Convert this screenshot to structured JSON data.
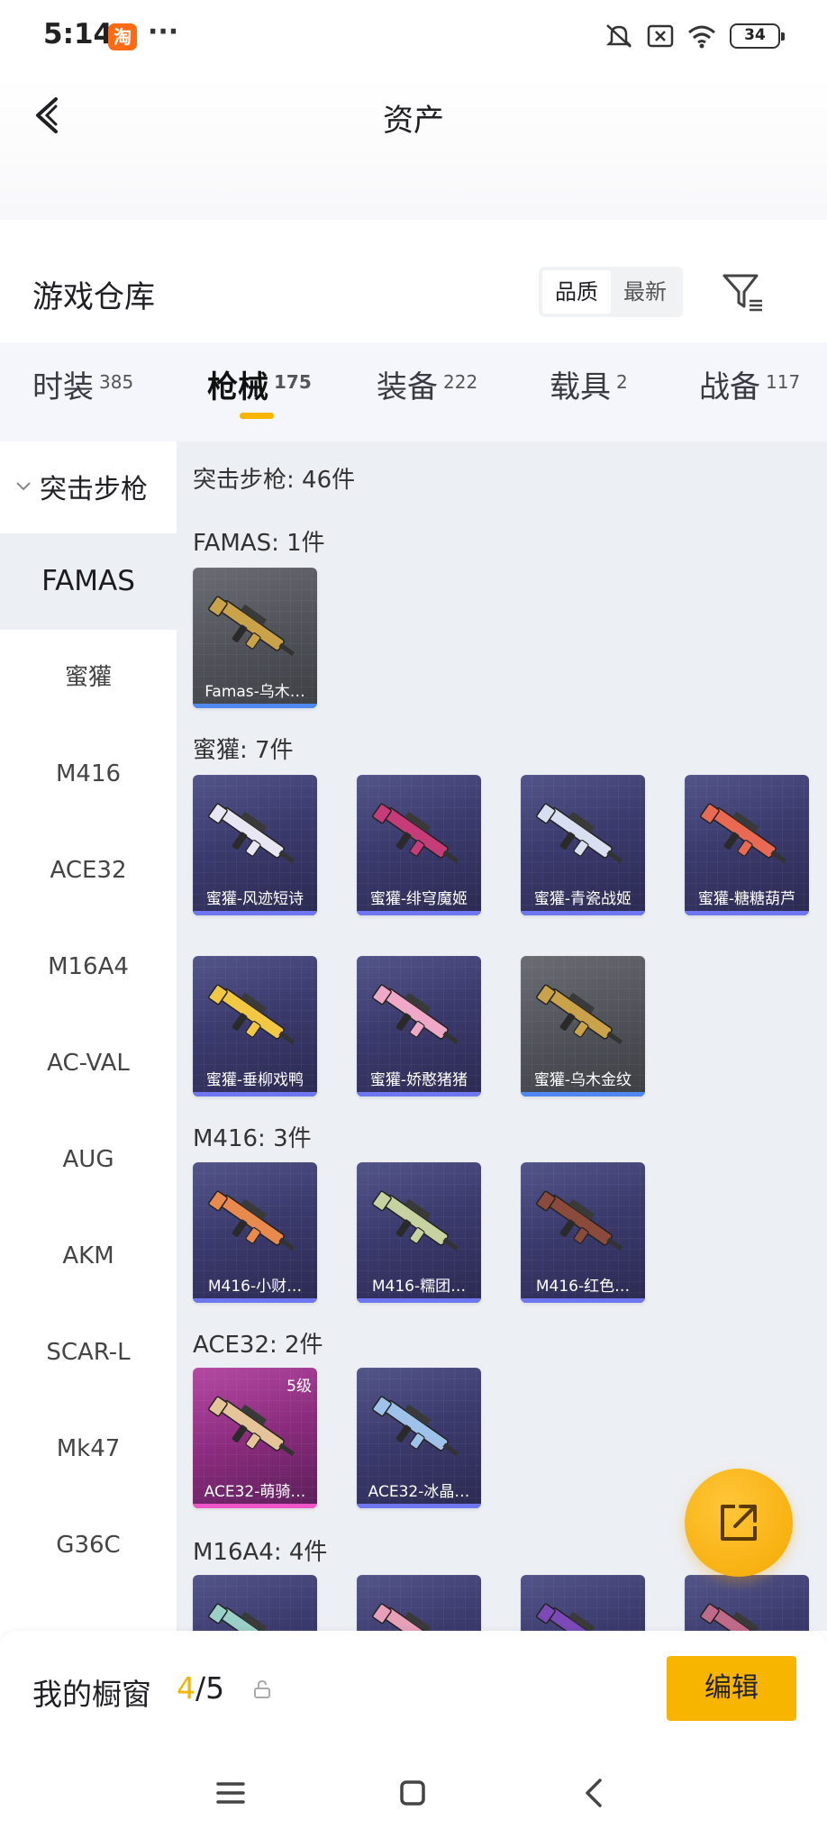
{
  "status": {
    "time": "5:14",
    "taobao": "淘",
    "dots": "···",
    "battery": "34"
  },
  "header": {
    "title": "资产"
  },
  "warehouse": {
    "title": "游戏仓库",
    "sort_quality": "品质",
    "sort_newest": "最新"
  },
  "tabs": [
    {
      "label": "时装",
      "count": "385"
    },
    {
      "label": "枪械",
      "count": "175"
    },
    {
      "label": "装备",
      "count": "222"
    },
    {
      "label": "载具",
      "count": "2"
    },
    {
      "label": "战备",
      "count": "117"
    }
  ],
  "sidebar": {
    "group": "突击步枪",
    "items": [
      "FAMAS",
      "蜜獾",
      "M416",
      "ACE32",
      "M16A4",
      "AC-VAL",
      "AUG",
      "AKM",
      "SCAR-L",
      "Mk47",
      "G36C"
    ]
  },
  "content": {
    "total": "突击步枪: 46件",
    "sections": [
      {
        "title": "FAMAS: 1件",
        "items": [
          {
            "label": "Famas-乌木…",
            "style": "grey",
            "gun": "#c9a24a"
          }
        ]
      },
      {
        "title": "蜜獾: 7件",
        "items": [
          {
            "label": "蜜獾-风迹短诗",
            "style": "purple",
            "gun": "#e8e6f2"
          },
          {
            "label": "蜜獾-绯穹魔姬",
            "style": "purple",
            "gun": "#c63c78"
          },
          {
            "label": "蜜獾-青瓷战姬",
            "style": "purple",
            "gun": "#d7dff0"
          },
          {
            "label": "蜜獾-糖糖葫芦",
            "style": "purple",
            "gun": "#e86a52"
          },
          {
            "label": "蜜獾-垂柳戏鸭",
            "style": "purple",
            "gun": "#f2c744"
          },
          {
            "label": "蜜獾-娇憨猪猪",
            "style": "purple",
            "gun": "#f0a8c8"
          },
          {
            "label": "蜜獾-乌木金纹",
            "style": "grey",
            "gun": "#c9a24a"
          }
        ]
      },
      {
        "title": "M416: 3件",
        "items": [
          {
            "label": "M416-小财…",
            "style": "purple",
            "gun": "#e8894e"
          },
          {
            "label": "M416-糯团…",
            "style": "purple",
            "gun": "#c6d2a0"
          },
          {
            "label": "M416-红色…",
            "style": "purple",
            "gun": "#8a4a3c"
          }
        ]
      },
      {
        "title": "ACE32: 2件",
        "items": [
          {
            "label": "ACE32-萌骑…",
            "style": "pink",
            "gun": "#e6c49a",
            "level": "5级"
          },
          {
            "label": "ACE32-冰晶…",
            "style": "purple",
            "gun": "#9fc2ea"
          }
        ]
      },
      {
        "title": "M16A4: 4件",
        "items": [
          {
            "label": "",
            "style": "purple",
            "gun": "#9ad0c8"
          },
          {
            "label": "",
            "style": "purple",
            "gun": "#e8a0b8"
          },
          {
            "label": "",
            "style": "purple",
            "gun": "#7b4ab8"
          },
          {
            "label": "",
            "style": "purple",
            "gun": "#c06a8a"
          }
        ]
      }
    ]
  },
  "showcase": {
    "title": "我的橱窗",
    "current": "4",
    "total": "/5",
    "edit_label": "编辑"
  },
  "colors": {
    "accent": "#f7b500",
    "content_bg": "#eceff4",
    "card_purple": "#3b3a6d",
    "card_grey": "#4e5157",
    "card_pink": "#8b2b7d"
  }
}
